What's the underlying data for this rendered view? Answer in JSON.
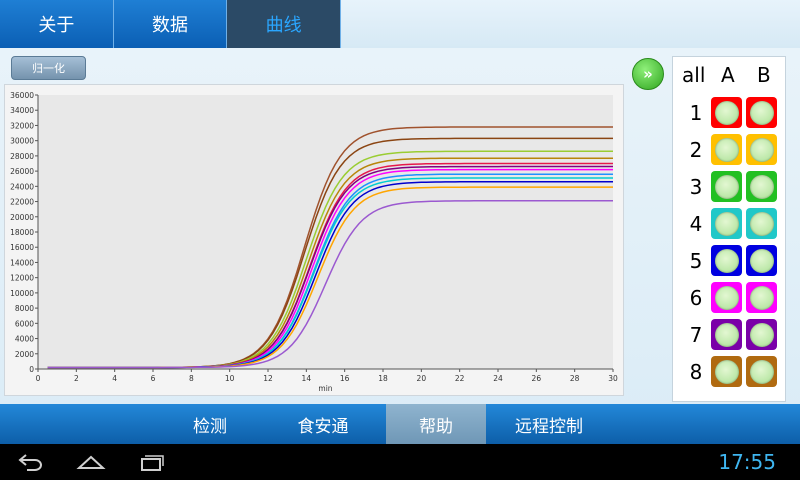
{
  "top_tabs": [
    {
      "label": "关于",
      "active": false
    },
    {
      "label": "数据",
      "active": false
    },
    {
      "label": "曲线",
      "active": true
    }
  ],
  "normalize_label": "归一化",
  "chart_data": {
    "type": "line",
    "xlabel": "min",
    "ylabel": "",
    "title": "",
    "xlim": [
      0,
      30
    ],
    "ylim": [
      0,
      36000
    ],
    "xticks": [
      0,
      2,
      4,
      6,
      8,
      10,
      12,
      14,
      16,
      18,
      20,
      22,
      24,
      26,
      28,
      30
    ],
    "yticks": [
      0,
      2000,
      4000,
      6000,
      8000,
      10000,
      12000,
      14000,
      16000,
      18000,
      20000,
      22000,
      24000,
      26000,
      28000,
      30000,
      32000,
      34000,
      36000
    ],
    "grid": false,
    "series": [
      {
        "color": "#a0522d",
        "plateau": 31800,
        "midpoint": 13.9
      },
      {
        "color": "#8b4513",
        "plateau": 30300,
        "midpoint": 13.9
      },
      {
        "color": "#9acd32",
        "plateau": 28600,
        "midpoint": 14.0
      },
      {
        "color": "#b8860b",
        "plateau": 27700,
        "midpoint": 14.1
      },
      {
        "color": "#e6194b",
        "plateau": 27000,
        "midpoint": 14.2
      },
      {
        "color": "#800080",
        "plateau": 26600,
        "midpoint": 14.2
      },
      {
        "color": "#ff00ff",
        "plateau": 26200,
        "midpoint": 14.3
      },
      {
        "color": "#1e90ff",
        "plateau": 25600,
        "midpoint": 14.4
      },
      {
        "color": "#00ced1",
        "plateau": 25100,
        "midpoint": 14.4
      },
      {
        "color": "#0000cd",
        "plateau": 24600,
        "midpoint": 14.5
      },
      {
        "color": "#ffa500",
        "plateau": 23900,
        "midpoint": 14.6
      },
      {
        "color": "#9b59d0",
        "plateau": 22100,
        "midpoint": 15.0
      }
    ]
  },
  "panel": {
    "play_icon": "fast-forward-icon",
    "play_label": "»",
    "header_all": "all",
    "header_a": "A",
    "header_b": "B",
    "rows": [
      {
        "label": "1",
        "color": "#ff0000"
      },
      {
        "label": "2",
        "color": "#ffc000"
      },
      {
        "label": "3",
        "color": "#22c022"
      },
      {
        "label": "4",
        "color": "#20c8c8"
      },
      {
        "label": "5",
        "color": "#0000e0"
      },
      {
        "label": "6",
        "color": "#ff00ff"
      },
      {
        "label": "7",
        "color": "#7a00a8"
      },
      {
        "label": "8",
        "color": "#b06a10"
      }
    ]
  },
  "bottom_nav": [
    {
      "label": "检测",
      "active": false
    },
    {
      "label": "食安通",
      "active": false
    },
    {
      "label": "帮助",
      "active": true
    },
    {
      "label": "远程控制",
      "active": false
    }
  ],
  "system": {
    "icons": [
      "back-icon",
      "home-icon",
      "recent-apps-icon"
    ],
    "time": "17:55"
  }
}
